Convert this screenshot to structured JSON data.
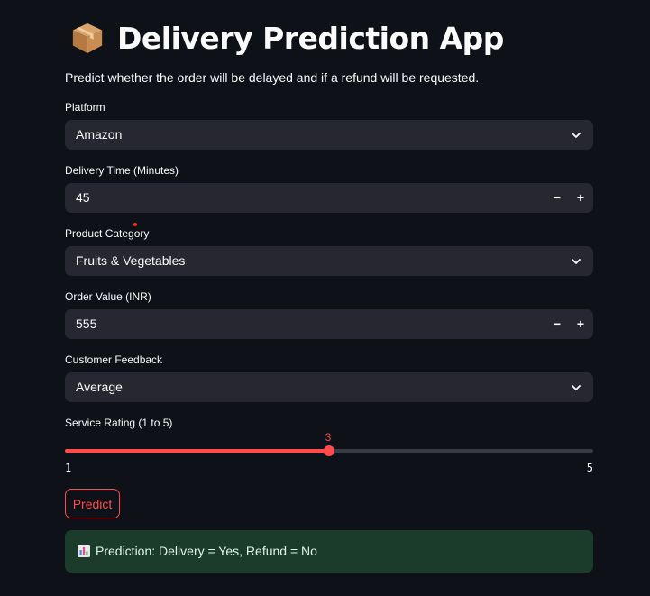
{
  "app": {
    "title": "Delivery Prediction App",
    "title_icon": "package-icon",
    "description": "Predict whether the order will be delayed and if a refund will be requested."
  },
  "form": {
    "platform": {
      "label": "Platform",
      "value": "Amazon"
    },
    "delivery_time": {
      "label": "Delivery Time (Minutes)",
      "value": "45",
      "minus": "−",
      "plus": "+"
    },
    "product_category": {
      "label": "Product Category",
      "value": "Fruits & Vegetables"
    },
    "order_value": {
      "label": "Order Value (INR)",
      "value": "555",
      "minus": "−",
      "plus": "+"
    },
    "customer_feedback": {
      "label": "Customer Feedback",
      "value": "Average"
    },
    "service_rating": {
      "label": "Service Rating (1 to 5)",
      "value": "3",
      "min": "1",
      "max": "5",
      "fraction": 0.5
    }
  },
  "actions": {
    "predict_label": "Predict"
  },
  "result": {
    "icon": "bar-chart-icon",
    "text": "Prediction: Delivery = Yes, Refund = No"
  },
  "colors": {
    "background": "#0e1117",
    "input_bg": "#262730",
    "accent": "#ff4b4b",
    "success_bg": "#1b3c2b"
  }
}
